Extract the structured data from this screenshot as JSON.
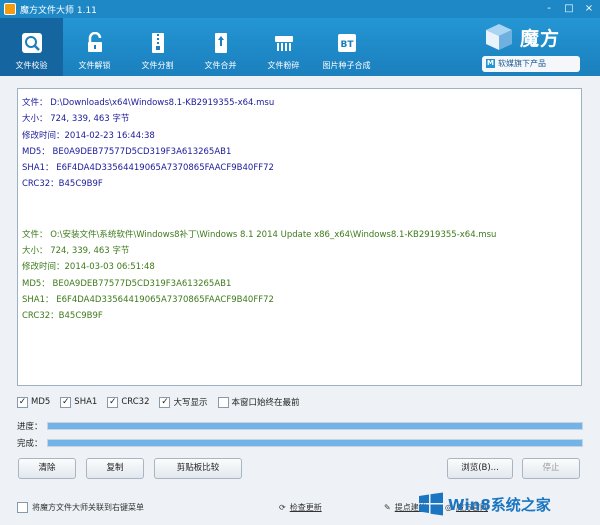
{
  "window": {
    "title": "魔方文件大师 1.11",
    "controls": [
      "-",
      "□",
      "×"
    ]
  },
  "toolbar": {
    "tools": [
      {
        "label": "文件校验",
        "icon": "search-icon",
        "active": true
      },
      {
        "label": "文件解锁",
        "icon": "unlock-icon",
        "active": false
      },
      {
        "label": "文件分割",
        "icon": "zip-icon",
        "active": false
      },
      {
        "label": "文件合并",
        "icon": "merge-icon",
        "active": false
      },
      {
        "label": "文件粉碎",
        "icon": "shredder-icon",
        "active": false
      },
      {
        "label": "图片种子合成",
        "icon": "bt-icon",
        "active": false
      }
    ]
  },
  "brand": {
    "name": "魔方",
    "sub": "软媒旗下产品",
    "sub_icon": "M"
  },
  "results": [
    {
      "color": "#1a1a9a",
      "lines": [
        "文件：  D:\\Downloads\\x64\\Windows8.1-KB2919355-x64.msu",
        "大小：  724, 339, 463 字节",
        "修改时间：2014-02-23 16:44:38",
        "MD5：  BE0A9DEB77577D5CD319F3A613265AB1",
        "SHA1：  E6F4DA4D33564419065A7370865FAACF9B40FF72",
        "CRC32：B45C9B9F"
      ]
    },
    {
      "color": "#3d7a1a",
      "lines": [
        "文件：  O:\\安装文件\\系统软件\\Windows8补丁\\Windows 8.1 2014 Update x86_x64\\Windows8.1-KB2919355-x64.msu",
        "大小：  724, 339, 463 字节",
        "修改时间：2014-03-03 06:51:48",
        "MD5：  BE0A9DEB77577D5CD319F3A613265AB1",
        "SHA1：  E6F4DA4D33564419065A7370865FAACF9B40FF72",
        "CRC32：B45C9B9F"
      ]
    }
  ],
  "options": [
    {
      "label": "MD5",
      "checked": true
    },
    {
      "label": "SHA1",
      "checked": true
    },
    {
      "label": "CRC32",
      "checked": true
    },
    {
      "label": "大写显示",
      "checked": true
    },
    {
      "label": "本窗口始终在最前",
      "checked": false
    }
  ],
  "progress": {
    "current_label": "进度：",
    "current_value": 1.0,
    "total_label": "完成：",
    "total_value": 1.0
  },
  "buttons": {
    "clear": "清除",
    "copy": "复制",
    "compare": "剪贴板比较",
    "browse": "浏览(B)...",
    "stop": "停止"
  },
  "bottom": {
    "associate": "将魔方文件大师关联到右键菜单",
    "update": "检查更新",
    "suggest": "提点建议",
    "website": "魔方官网"
  },
  "watermark": "Win8系统之家"
}
